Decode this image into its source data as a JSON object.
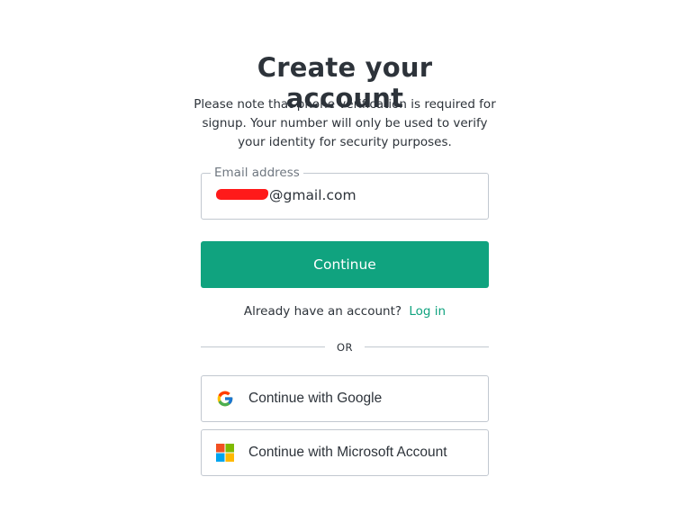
{
  "header": {
    "title": "Create your account",
    "subtitle": "Please note that phone verification is required for signup. Your number will only be used to verify your identity for security purposes."
  },
  "email_field": {
    "label": "Email address",
    "value_suffix": "@gmail.com",
    "redacted": true
  },
  "continue_button": {
    "label": "Continue",
    "color": "#10a37f"
  },
  "login_prompt": {
    "text": "Already have an account?",
    "link_label": "Log in",
    "link_color": "#10a37f"
  },
  "divider": {
    "label": "OR"
  },
  "social_buttons": [
    {
      "label": "Continue with Google",
      "icon": "google-icon"
    },
    {
      "label": "Continue with Microsoft Account",
      "icon": "microsoft-icon"
    }
  ]
}
